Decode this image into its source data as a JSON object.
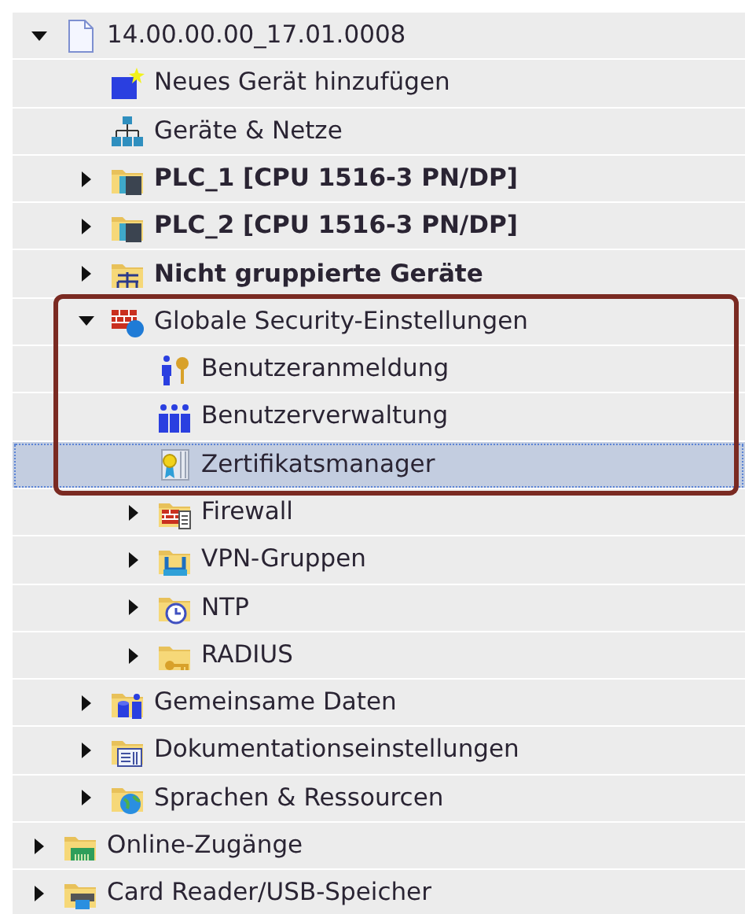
{
  "tree": [
    {
      "label": "14.00.00.00_17.01.0008",
      "kind": "project",
      "expanded": true,
      "bold": false,
      "selected": false,
      "highlighted": false,
      "children": [
        {
          "label": "Neues Gerät hinzufügen",
          "kind": "add-device",
          "bold": false,
          "selected": false,
          "highlighted": false
        },
        {
          "label": "Geräte & Netze",
          "kind": "network",
          "bold": false,
          "selected": false,
          "highlighted": false
        },
        {
          "label": "PLC_1 [CPU 1516-3 PN/DP]",
          "kind": "plc",
          "expanded": false,
          "bold": true,
          "selected": false,
          "highlighted": false
        },
        {
          "label": "PLC_2 [CPU 1516-3 PN/DP]",
          "kind": "plc",
          "expanded": false,
          "bold": true,
          "selected": false,
          "highlighted": false
        },
        {
          "label": "Nicht gruppierte Geräte",
          "kind": "ungrouped",
          "expanded": false,
          "bold": true,
          "selected": false,
          "highlighted": false
        },
        {
          "label": "Globale Security-Einstellungen",
          "kind": "security",
          "expanded": true,
          "bold": false,
          "selected": false,
          "highlighted": true,
          "children": [
            {
              "label": "Benutzeranmeldung",
              "kind": "user-login",
              "bold": false,
              "selected": false,
              "highlighted": true
            },
            {
              "label": "Benutzerverwaltung",
              "kind": "user-admin",
              "bold": false,
              "selected": false,
              "highlighted": true
            },
            {
              "label": "Zertifikatsmanager",
              "kind": "certificate",
              "bold": false,
              "selected": true,
              "highlighted": true
            },
            {
              "label": "Firewall",
              "kind": "firewall",
              "expanded": false,
              "bold": false,
              "selected": false,
              "highlighted": false
            },
            {
              "label": "VPN-Gruppen",
              "kind": "vpn",
              "expanded": false,
              "bold": false,
              "selected": false,
              "highlighted": false
            },
            {
              "label": "NTP",
              "kind": "ntp",
              "expanded": false,
              "bold": false,
              "selected": false,
              "highlighted": false
            },
            {
              "label": "RADIUS",
              "kind": "radius",
              "expanded": false,
              "bold": false,
              "selected": false,
              "highlighted": false
            }
          ]
        },
        {
          "label": "Gemeinsame Daten",
          "kind": "common-data",
          "expanded": false,
          "bold": false,
          "selected": false,
          "highlighted": false
        },
        {
          "label": "Dokumentationseinstellungen",
          "kind": "documentation",
          "expanded": false,
          "bold": false,
          "selected": false,
          "highlighted": false
        },
        {
          "label": "Sprachen & Ressourcen",
          "kind": "languages",
          "expanded": false,
          "bold": false,
          "selected": false,
          "highlighted": false
        }
      ]
    },
    {
      "label": "Online-Zugänge",
      "kind": "online",
      "expanded": false,
      "bold": false,
      "selected": false,
      "highlighted": false
    },
    {
      "label": "Card Reader/USB-Speicher",
      "kind": "card-reader",
      "expanded": false,
      "bold": false,
      "selected": false,
      "highlighted": false
    }
  ]
}
